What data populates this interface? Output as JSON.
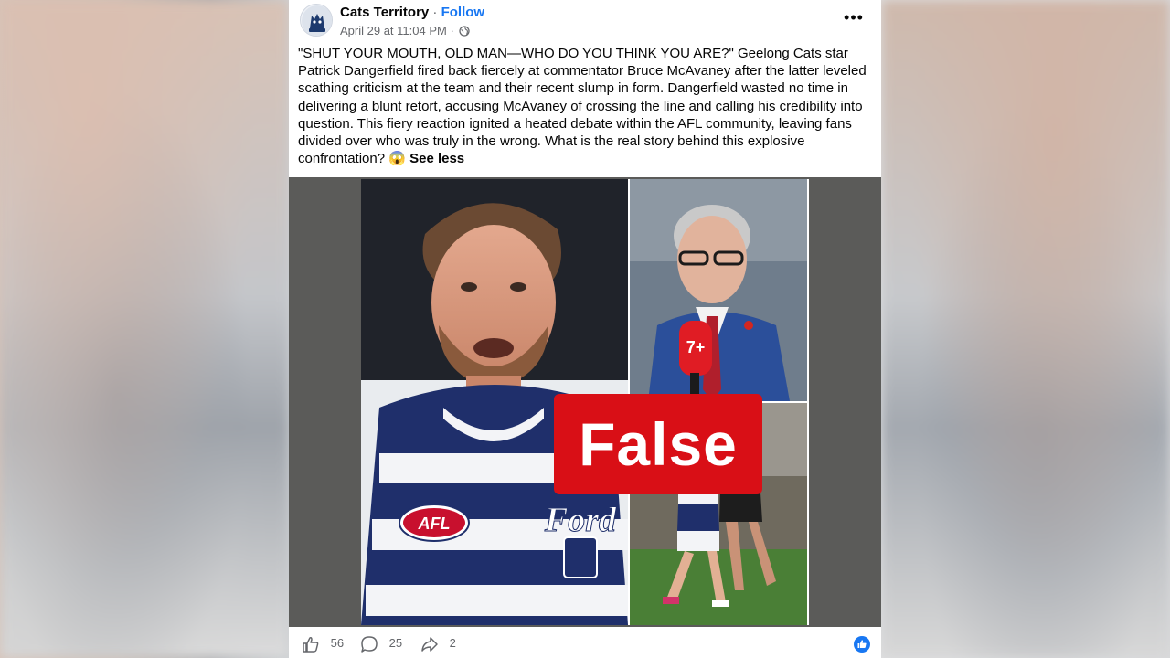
{
  "post": {
    "page_name": "Cats Territory",
    "separator": " · ",
    "follow_label": "Follow",
    "timestamp": "April 29 at 11:04 PM",
    "meta_sep": " · ",
    "more_label": "•••",
    "body_text": "\"SHUT YOUR MOUTH, OLD MAN—WHO DO YOU THINK YOU ARE?\" Geelong Cats star Patrick Dangerfield fired back fiercely at commentator Bruce McAvaney after the latter leveled scathing criticism at the team and their recent slump in form. Dangerfield wasted no time in delivering a blunt retort, accusing McAvaney of crossing the line and calling his credibility into question. This fiery reaction ignited a heated debate within the AFL community, leaving fans divided over who was truly in the wrong. What is the real story behind this explosive confrontation? 😱 ",
    "see_less_label": "See less"
  },
  "media": {
    "badge_text": "False",
    "jersey_brand": "Ford",
    "league_logo": "AFL",
    "mic_logo": "7+"
  },
  "footer": {
    "likes": "56",
    "comments": "25",
    "shares": "2"
  },
  "icons": {
    "avatar": "cats-logo-icon",
    "globe": "globe-icon",
    "like": "thumbs-up-icon",
    "comment": "comment-icon",
    "share": "share-icon"
  },
  "colors": {
    "accent": "#1877f2",
    "badge": "#d90f16",
    "text": "#050505",
    "muted": "#65676b"
  }
}
